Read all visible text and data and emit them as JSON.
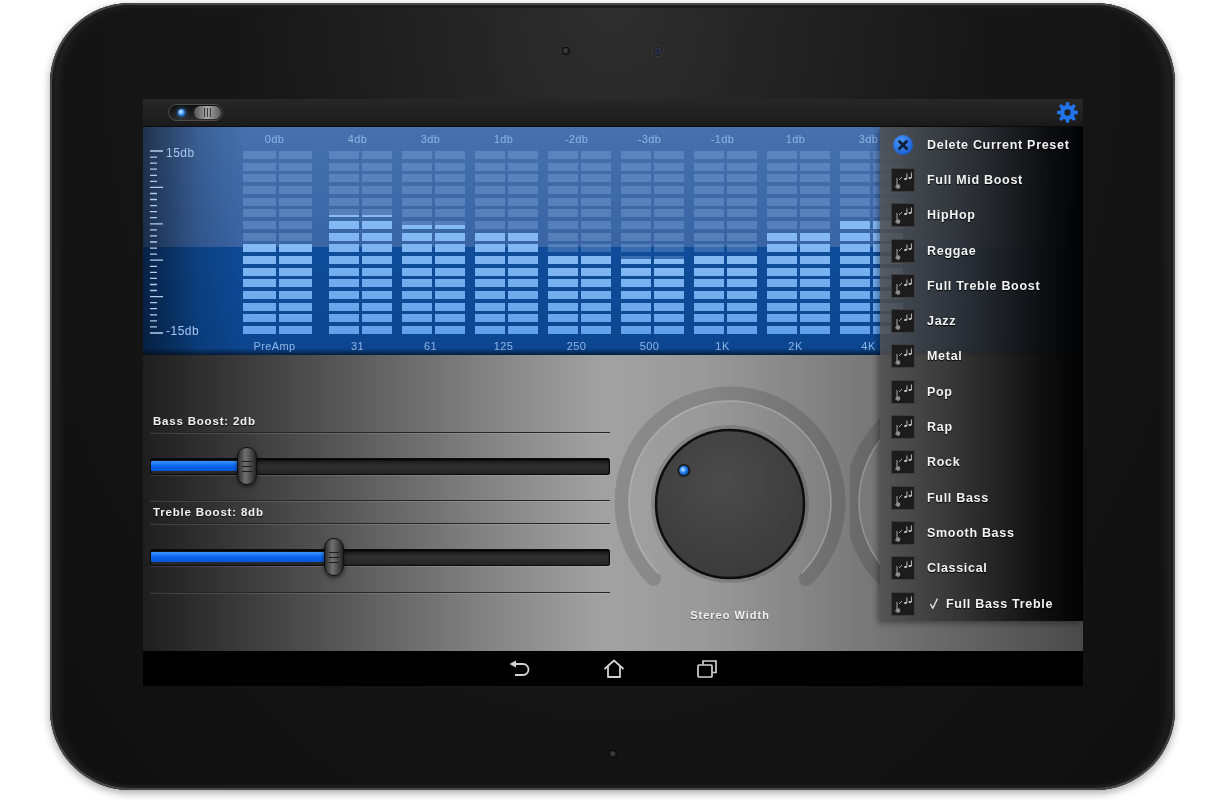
{
  "top_bar": {
    "power_switch": {
      "on": true
    }
  },
  "equalizer": {
    "scale": {
      "top_label": "15db",
      "bottom_label": "-15db"
    },
    "bands": [
      {
        "gain": "0db",
        "frequency": "PreAmp",
        "level": 0.5
      },
      {
        "gain": "4db",
        "frequency": "31",
        "level": 0.65
      },
      {
        "gain": "3db",
        "frequency": "61",
        "level": 0.595
      },
      {
        "gain": "1db",
        "frequency": "125",
        "level": 0.56
      },
      {
        "gain": "-2db",
        "frequency": "250",
        "level": 0.445
      },
      {
        "gain": "-3db",
        "frequency": "500",
        "level": 0.41
      },
      {
        "gain": "-1db",
        "frequency": "1K",
        "level": 0.45
      },
      {
        "gain": "1db",
        "frequency": "2K",
        "level": 0.56
      },
      {
        "gain": "3db",
        "frequency": "4K",
        "level": 0.62
      }
    ]
  },
  "sliders": [
    {
      "label": "Bass Boost: 2db",
      "level": 0.21
    },
    {
      "label": "Treble Boost: 8db",
      "level": 0.4
    }
  ],
  "knobs": [
    {
      "label": "Stereo Width",
      "level": 0.3
    }
  ],
  "preset_menu": {
    "delete_action": {
      "label": "Delete Current Preset"
    },
    "presets": [
      {
        "label": "Full Mid Boost",
        "selected": false
      },
      {
        "label": "HipHop",
        "selected": false
      },
      {
        "label": "Reggae",
        "selected": false
      },
      {
        "label": "Full Treble Boost",
        "selected": false
      },
      {
        "label": "Jazz",
        "selected": false
      },
      {
        "label": "Metal",
        "selected": false
      },
      {
        "label": "Pop",
        "selected": false
      },
      {
        "label": "Rap",
        "selected": false
      },
      {
        "label": "Rock",
        "selected": false
      },
      {
        "label": "Full Bass",
        "selected": false
      },
      {
        "label": "Smooth Bass",
        "selected": false
      },
      {
        "label": "Classical",
        "selected": false
      },
      {
        "label": "Full Bass Treble",
        "selected": true
      }
    ]
  }
}
